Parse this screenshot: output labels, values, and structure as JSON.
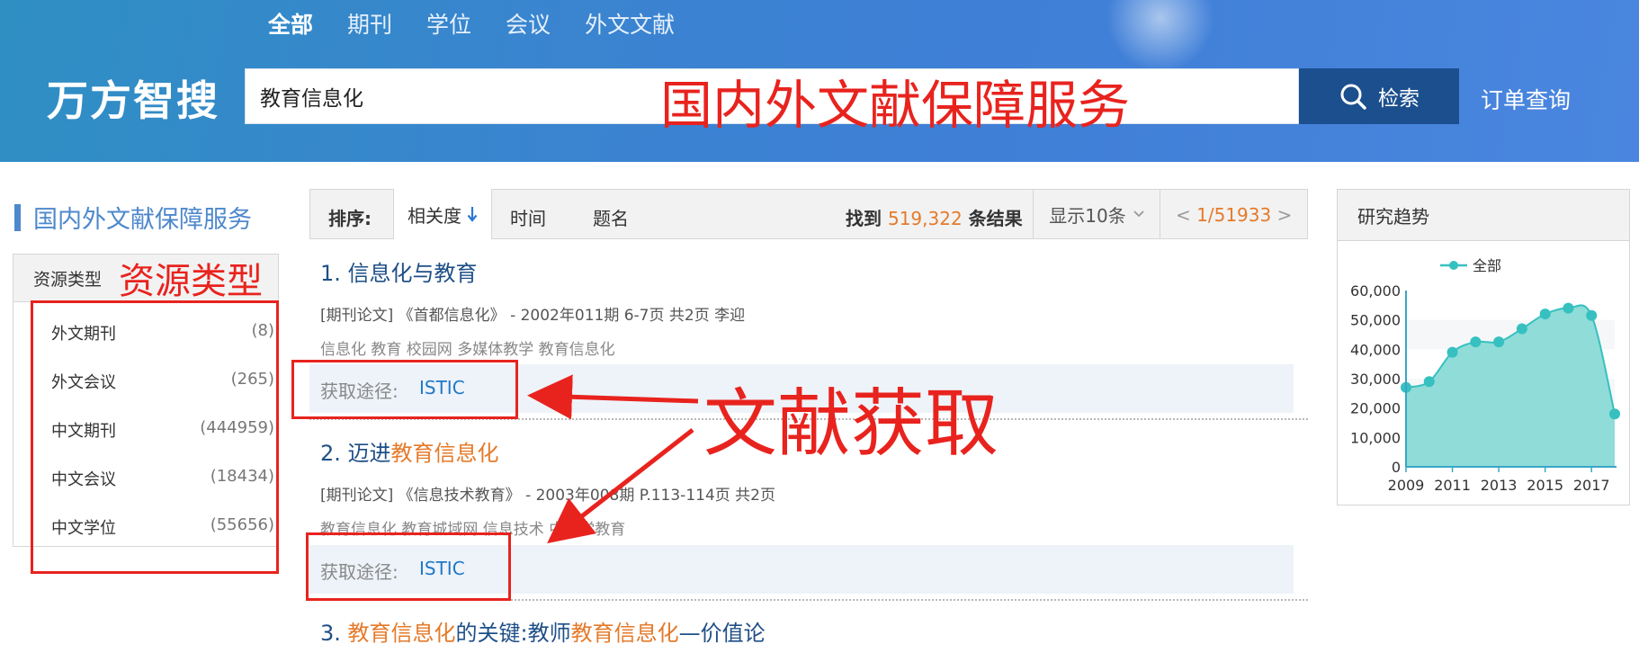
{
  "header": {
    "tabs": [
      {
        "label": "全部"
      },
      {
        "label": "期刊"
      },
      {
        "label": "学位"
      },
      {
        "label": "会议"
      },
      {
        "label": "外文文献"
      }
    ],
    "logo": "万方智搜",
    "search_value": "教育信息化",
    "search_button": "检索",
    "order_link": "订单查询",
    "overlay_text": "国内外文献保障服务"
  },
  "sidebar": {
    "title": "国内外文献保障服务",
    "panel_title": "资源类型",
    "panel_annotation": "资源类型",
    "items": [
      {
        "label": "外文期刊",
        "count": "(8)"
      },
      {
        "label": "外文会议",
        "count": "(265)"
      },
      {
        "label": "中文期刊",
        "count": "(444959)"
      },
      {
        "label": "中文会议",
        "count": "(18434)"
      },
      {
        "label": "中文学位",
        "count": "(55656)"
      }
    ]
  },
  "sortbar": {
    "label": "排序:",
    "relevance": "相关度",
    "time": "时间",
    "title": "题名",
    "found_prefix": "找到",
    "found_count": "519,322",
    "found_suffix": "条结果",
    "page_size": "显示10条",
    "page_prev": "<",
    "page_current": "1",
    "page_total": "/51933",
    "page_next": ">"
  },
  "results": [
    {
      "num": "1.",
      "title_parts": [
        "信息化与教育",
        ""
      ],
      "meta": "[期刊论文] 《首都信息化》 - 2002年011期   6-7页   共2页   李迎",
      "keywords": "信息化 教育 校园网 多媒体教学 教育信息化",
      "access_label": "获取途径:",
      "access_link": "ISTIC"
    },
    {
      "num": "2.",
      "title_parts": [
        "迈进",
        "教育信息化"
      ],
      "meta": "[期刊论文] 《信息技术教育》 - 2003年008期   P.113-114页   共2页",
      "keywords": "教育信息化 教育城域网 信息技术 中小学教育",
      "access_label": "获取途径:",
      "access_link": "ISTIC"
    },
    {
      "num": "3.",
      "title_parts": [
        "教育信息化",
        "的关键:教师",
        "教育信息化",
        "—价值论"
      ]
    }
  ],
  "annotation": {
    "access_text": "文献获取"
  },
  "trend": {
    "title": "研究趋势",
    "legend": "全部"
  },
  "chart_data": {
    "type": "area",
    "title": "研究趋势",
    "series": [
      {
        "name": "全部",
        "values": [
          27000,
          29000,
          39000,
          42500,
          42500,
          47000,
          52000,
          54000,
          51500,
          18000
        ]
      }
    ],
    "x": [
      2009,
      2010,
      2011,
      2012,
      2013,
      2014,
      2015,
      2016,
      2017,
      2018
    ],
    "x_tick_labels": [
      "2009",
      "2011",
      "2013",
      "2015",
      "2017"
    ],
    "y_tick_labels": [
      "60,000",
      "50,000",
      "40,000",
      "30,000",
      "20,000",
      "10,000",
      "0"
    ],
    "ylim": [
      0,
      60000
    ],
    "color": "#37c0c0",
    "fill": "#8fdcd8"
  }
}
